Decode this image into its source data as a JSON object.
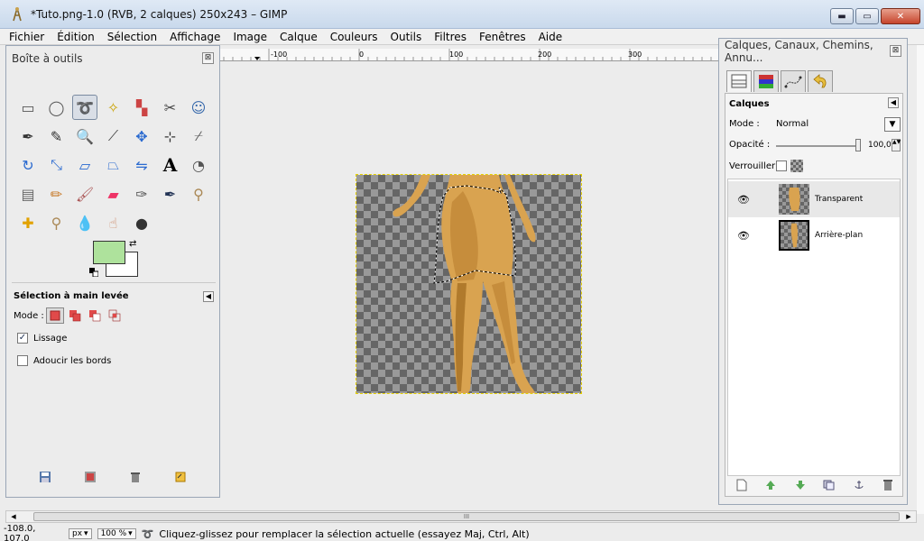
{
  "window": {
    "title": "*Tuto.png-1.0 (RVB, 2 calques) 250x243 – GIMP",
    "buttons": {
      "minimize": "▬",
      "maximize": "▭",
      "close": "✕"
    }
  },
  "menubar": [
    "Fichier",
    "Édition",
    "Sélection",
    "Affichage",
    "Image",
    "Calque",
    "Couleurs",
    "Outils",
    "Filtres",
    "Fenêtres",
    "Aide"
  ],
  "ruler": {
    "labels": [
      {
        "text": "-100"
      },
      {
        "text": "0"
      },
      {
        "text": "100"
      },
      {
        "text": "200"
      },
      {
        "text": "300"
      }
    ]
  },
  "toolbox": {
    "title": "Boîte à outils",
    "close": "⊠",
    "tools": [
      "rect-select-icon",
      "ellipse-select-icon",
      "free-select-icon",
      "fuzzy-select-icon",
      "color-select-icon",
      "scissors-icon",
      "foreground-select-icon",
      "paths-icon",
      "color-picker-icon",
      "zoom-icon",
      "measure-icon",
      "move-icon",
      "align-icon",
      "crop-icon",
      "rotate-icon",
      "scale-icon",
      "shear-icon",
      "perspective-icon",
      "flip-icon",
      "text-icon",
      "bucket-fill-icon",
      "gradient-icon",
      "pencil-icon",
      "paintbrush-icon",
      "eraser-icon",
      "airbrush-icon",
      "ink-icon",
      "clone-icon",
      "heal-icon",
      "perspective-clone-icon",
      "blur-icon",
      "smudge-icon",
      "dodge-burn-icon"
    ],
    "active_tool": 2,
    "colors": {
      "foreground": "#aee29c",
      "background": "#ffffff"
    },
    "options": {
      "title": "Sélection à main levée",
      "mode_label": "Mode :",
      "antialias_label": "Lissage",
      "antialias_checked": true,
      "feather_label": "Adoucir les bords",
      "feather_checked": false
    }
  },
  "dock": {
    "title": "Calques, Canaux, Chemins, Annu...",
    "close": "⊠",
    "panel_title": "Calques",
    "mode_label": "Mode :",
    "mode_value": "Normal",
    "opacity_label": "Opacité :",
    "opacity_value": "100,0",
    "opacity_level": 1.0,
    "lock_label": "Verrouiller :",
    "layers": [
      {
        "name": "Transparent",
        "visible": true,
        "selected": true
      },
      {
        "name": "Arrière-plan",
        "visible": true,
        "selected": false
      }
    ]
  },
  "status": {
    "coords": "-108.0, 107.0",
    "units": "px",
    "zoom": "100 %",
    "message": "Cliquez-glissez pour remplacer la sélection actuelle (essayez Maj, Ctrl, Alt)"
  },
  "scroll": {
    "grip": "III"
  },
  "colors": {
    "accent": "#e5d000",
    "skin": "#d9a350",
    "skin_shadow": "#b07a2c"
  }
}
